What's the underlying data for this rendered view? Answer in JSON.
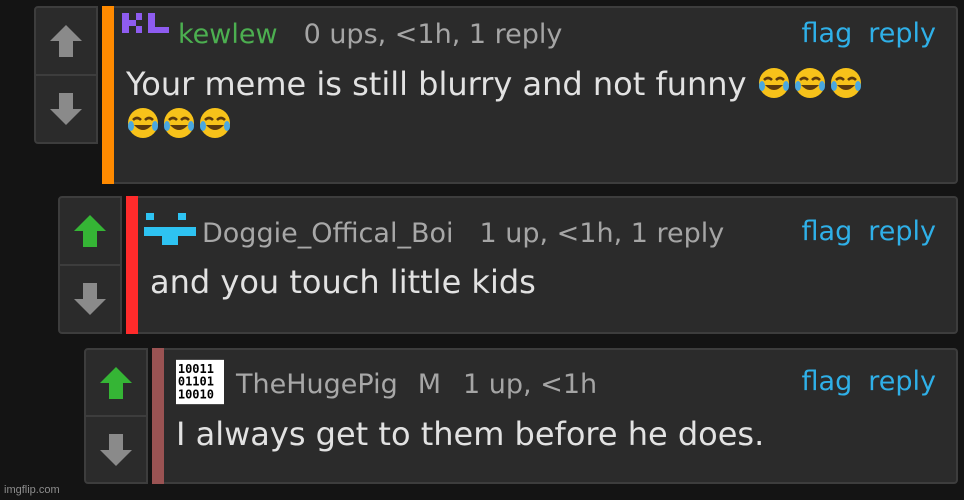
{
  "comments": [
    {
      "avatar_icon": "kl-pixel-avatar-icon",
      "username": "kewlew",
      "username_color": "#4caf50",
      "meta": "0 ups, <1h, 1 reply",
      "bar_color": "#ff8a00",
      "upvoted": false,
      "flag": "flag",
      "reply": "reply",
      "text": "Your meme is still blurry and not funny",
      "emoji_icon": "rolling-on-floor-laughing-icon"
    },
    {
      "avatar_icon": "doggie-pixel-avatar-icon",
      "username": "Doggie_Offical_Boi",
      "username_color": "#a8a8a8",
      "meta": "1 up, <1h, 1 reply",
      "bar_color": "#ff2b2b",
      "upvoted": true,
      "flag": "flag",
      "reply": "reply",
      "text": "and you touch little kids"
    },
    {
      "avatar_icon": "binary-avatar-icon",
      "username": "TheHugePig",
      "mod_badge": "M",
      "username_color": "#a8a8a8",
      "meta": "1 up, <1h",
      "bar_color": "#9a5353",
      "upvoted": true,
      "flag": "flag",
      "reply": "reply",
      "text": "I always get to them before he does."
    }
  ],
  "colors": {
    "upvote_active": "#35b535",
    "vote_idle": "#8a8a8a",
    "link": "#2fb0e8"
  },
  "watermark": "imgflip.com"
}
